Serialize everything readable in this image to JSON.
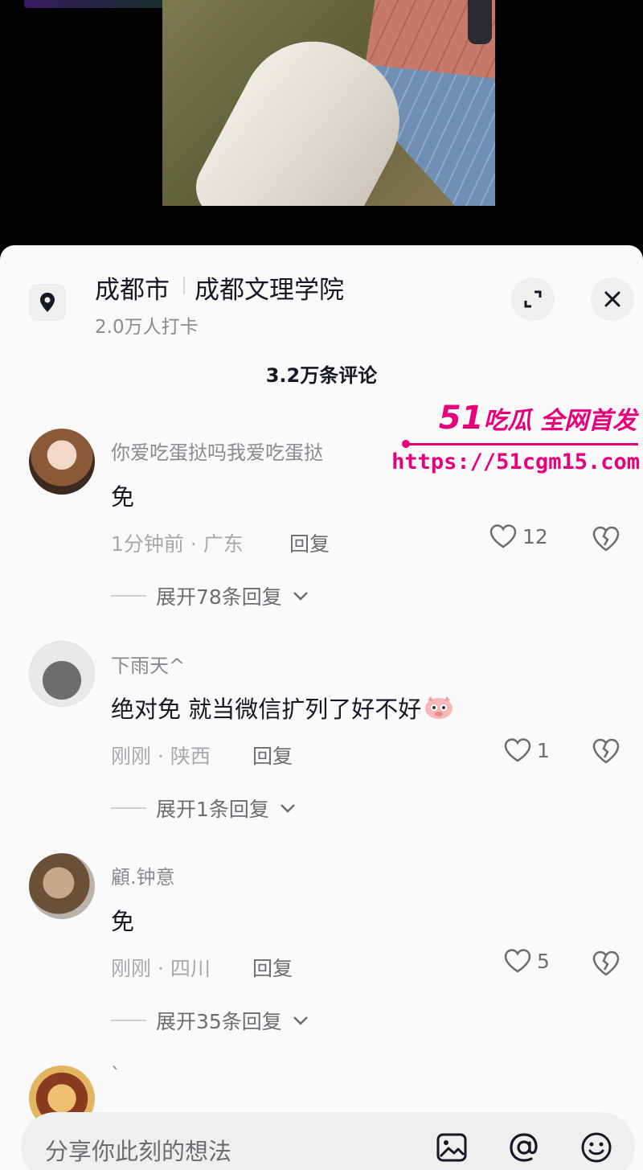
{
  "location": {
    "city": "成都市",
    "place": "成都文理学院",
    "checkins": "2.0万人打卡"
  },
  "comments_header": "3.2万条评论",
  "watermark": {
    "brand_num": "51",
    "brand_text": "吃瓜 全网首发",
    "url": "https://51cgm15.com"
  },
  "comments": [
    {
      "user": "你爱吃蛋挞吗我爱吃蛋挞",
      "text": "免",
      "meta": "1分钟前 · 广东",
      "reply": "回复",
      "likes": "12",
      "expand": "展开78条回复"
    },
    {
      "user": "下雨天^",
      "text": "绝对免 就当微信扩列了好不好",
      "meta": "刚刚 · 陕西",
      "reply": "回复",
      "likes": "1",
      "expand": "展开1条回复"
    },
    {
      "user": "顧.钟意",
      "text": "免",
      "meta": "刚刚 · 四川",
      "reply": "回复",
      "likes": "5",
      "expand": "展开35条回复"
    },
    {
      "user": "`"
    }
  ],
  "input": {
    "placeholder": "分享你此刻的想法"
  },
  "icons": [
    "location-pin-icon",
    "expand-icon",
    "close-icon",
    "heart-icon",
    "dislike-icon",
    "chevron-down-icon",
    "image-icon",
    "at-icon",
    "emoji-icon",
    "pig-emoji-icon"
  ]
}
